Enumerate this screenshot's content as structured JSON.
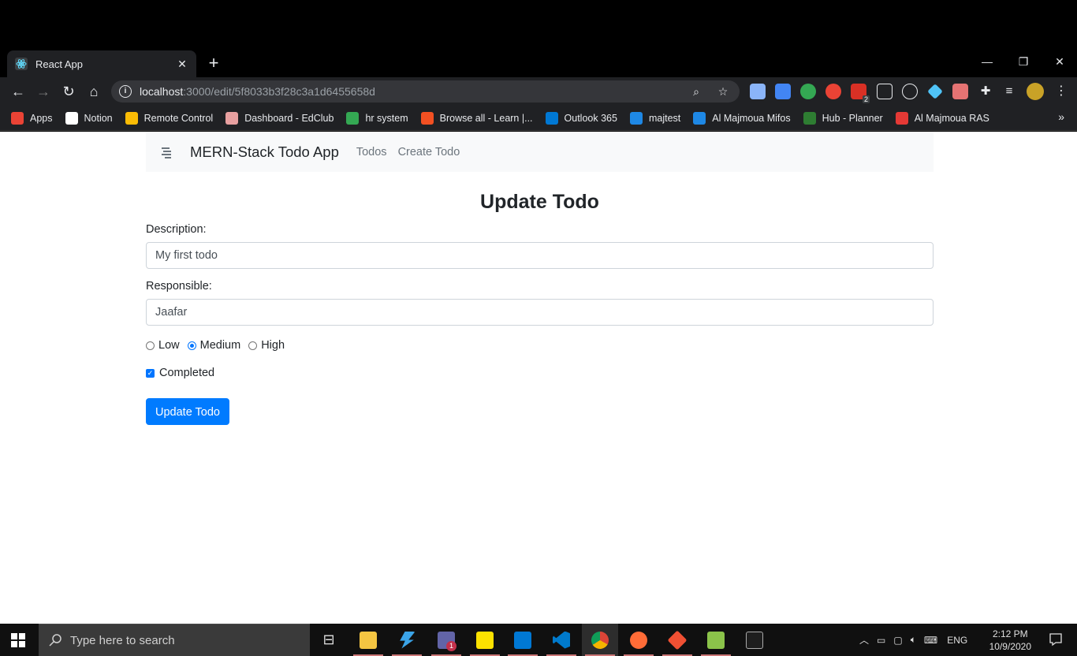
{
  "browser": {
    "tab_title": "React App",
    "tab_close": "✕",
    "new_tab": "+",
    "url_host": "localhost",
    "url_rest": ":3000/edit/5f8033b3f28c3a1d6455658d",
    "bookmarks": [
      {
        "label": "Apps",
        "color": "#ea4335"
      },
      {
        "label": "Notion",
        "color": "#ffffff"
      },
      {
        "label": "Remote Control",
        "color": "#fbbc05"
      },
      {
        "label": "Dashboard - EdClub",
        "color": "#e8a0a0"
      },
      {
        "label": "hr system",
        "color": "#34a853"
      },
      {
        "label": "Browse all - Learn |...",
        "color": "#f25022"
      },
      {
        "label": "Outlook 365",
        "color": "#0078d4"
      },
      {
        "label": "majtest",
        "color": "#1e88e5"
      },
      {
        "label": "Al Majmoua Mifos",
        "color": "#1e88e5"
      },
      {
        "label": "Hub - Planner",
        "color": "#2e7d32"
      },
      {
        "label": "Al Majmoua RAS",
        "color": "#e53935"
      }
    ],
    "bookmarks_more": "»"
  },
  "app": {
    "brand": "MERN-Stack Todo App",
    "nav_todos": "Todos",
    "nav_create": "Create Todo",
    "heading": "Update Todo",
    "description_label": "Description:",
    "description_value": "My first todo",
    "responsible_label": "Responsible:",
    "responsible_value": "Jaafar",
    "priority_low": "Low",
    "priority_medium": "Medium",
    "priority_high": "High",
    "priority_selected": "Medium",
    "completed_label": "Completed",
    "completed": true,
    "submit_label": "Update Todo"
  },
  "taskbar": {
    "search_placeholder": "Type here to search",
    "language": "ENG",
    "time": "2:12 PM",
    "date": "10/9/2020",
    "teams_badge": "1",
    "ext_badge": "2"
  }
}
